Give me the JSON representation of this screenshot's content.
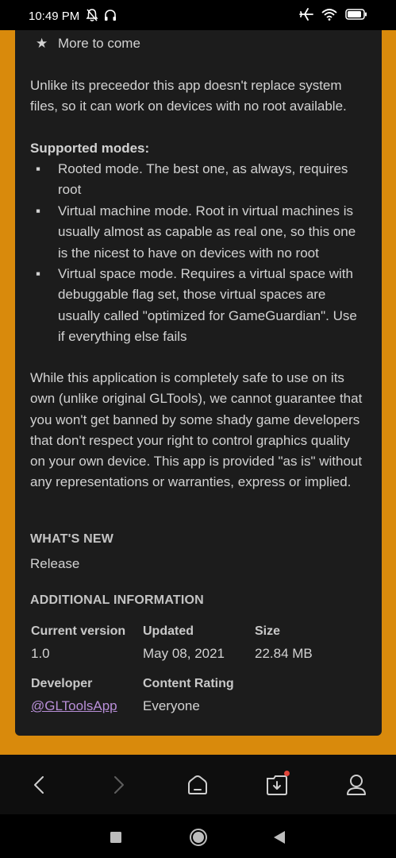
{
  "status": {
    "time": "10:49 PM"
  },
  "description": {
    "more_to_come": "More to come",
    "no_root_text": "Unlike its preceedor this app doesn't replace system files, so it can work on devices with no root available.",
    "modes_heading": "Supported modes:",
    "modes": [
      "Rooted mode. The best one, as always, requires root",
      "Virtual machine mode. Root in virtual machines is usually almost as capable as real one, so this one is the nicest to have on devices with no root",
      "Virtual space mode. Requires a virtual space with debuggable flag set, those virtual spaces are usually called \"optimized for GameGuardian\". Use if everything else fails"
    ],
    "disclaimer": "While this application is completely safe to use on its own (unlike original GLTools), we cannot guarantee that you won't get banned by some shady game developers that don't respect your right to control graphics quality on your own device. This app is provided \"as is\" without any representations or warranties, express or implied."
  },
  "whats_new": {
    "heading": "WHAT'S NEW",
    "text": "Release"
  },
  "additional_info": {
    "heading": "ADDITIONAL INFORMATION",
    "current_version_label": "Current version",
    "current_version": "1.0",
    "updated_label": "Updated",
    "updated": "May 08, 2021",
    "size_label": "Size",
    "size": "22.84 MB",
    "developer_label": "Developer",
    "developer": "@GLToolsApp",
    "content_rating_label": "Content Rating",
    "content_rating": "Everyone"
  },
  "colors": {
    "accent": "#d98a0c",
    "card": "#1c1c1c",
    "link": "#b98fd9",
    "badge": "#e0453a"
  }
}
